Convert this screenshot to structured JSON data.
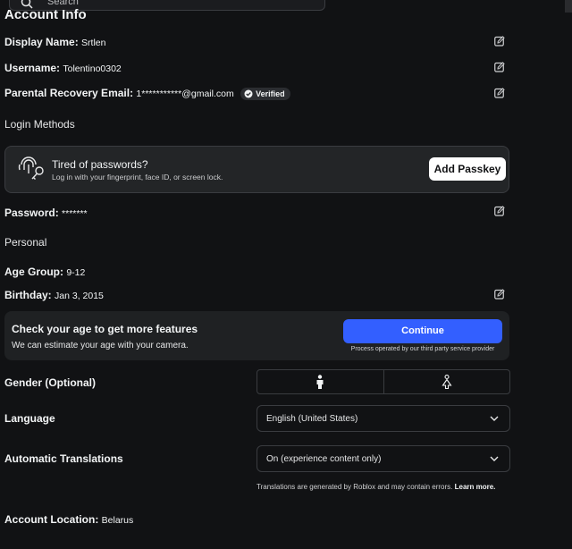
{
  "header": {
    "search_placeholder": "Search"
  },
  "account": {
    "title": "Account Info",
    "display_name": {
      "label": "Display Name:",
      "value": "Srtlen"
    },
    "username": {
      "label": "Username:",
      "value": "Tolentino0302"
    },
    "parental_email": {
      "label": "Parental Recovery Email:",
      "value": "1***********@gmail.com",
      "badge": "Verified"
    }
  },
  "login_methods": {
    "heading": "Login Methods",
    "passkey": {
      "title": "Tired of passwords?",
      "subtitle": "Log in with your fingerprint, face ID, or screen lock.",
      "button": "Add Passkey"
    },
    "password": {
      "label": "Password:",
      "value": "*******"
    }
  },
  "personal": {
    "heading": "Personal",
    "age_group": {
      "label": "Age Group:",
      "value": "9-12"
    },
    "birthday": {
      "label": "Birthday:",
      "value": "Jan 3, 2015"
    },
    "age_check": {
      "title": "Check your age to get more features",
      "subtitle": "We can estimate your age with your camera.",
      "button": "Continue",
      "note": "Process operated by our third party service provider"
    },
    "gender": {
      "label": "Gender (Optional)",
      "options": [
        "male-icon",
        "female-icon"
      ]
    },
    "language": {
      "label": "Language",
      "value": "English (United States)"
    },
    "translations": {
      "label": "Automatic Translations",
      "value": "On (experience content only)",
      "note": "Translations are generated by Roblox and may contain errors.",
      "link": "Learn more."
    },
    "location": {
      "label": "Account Location:",
      "value": "Belarus"
    }
  },
  "colors": {
    "background": "#111214",
    "card": "#232527",
    "accent": "#335fff",
    "text": "#f2f4f5"
  }
}
